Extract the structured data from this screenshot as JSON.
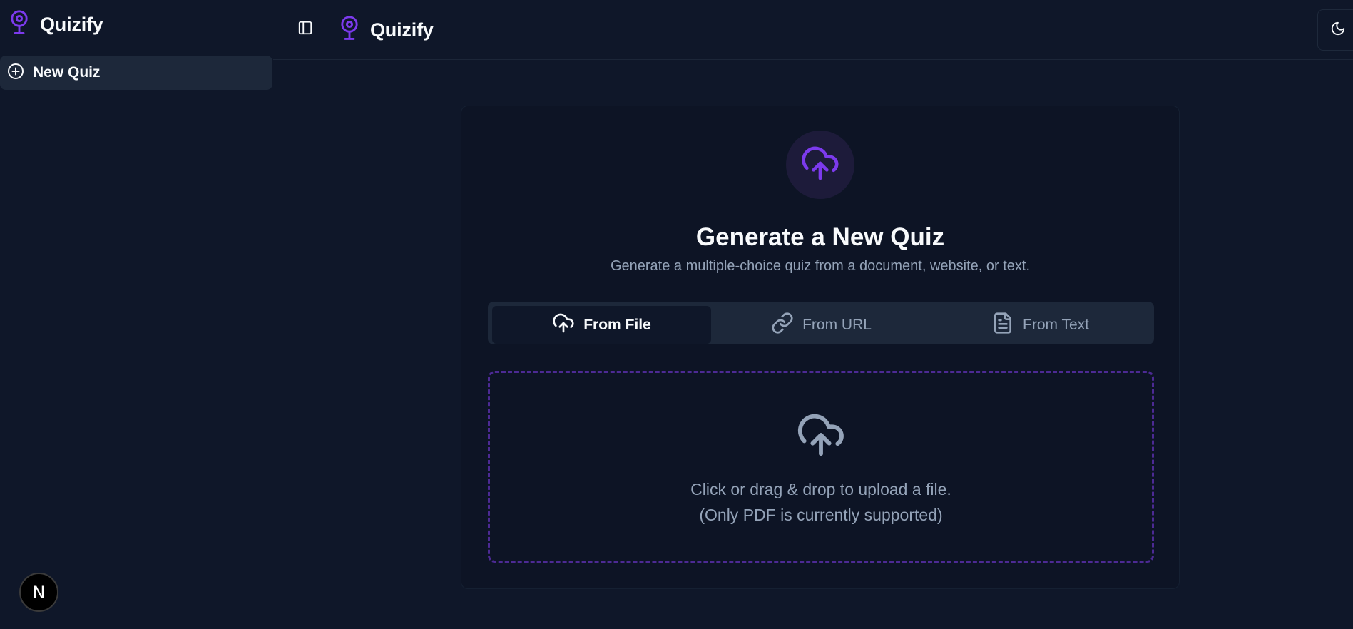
{
  "sidebar": {
    "brand": "Quizify",
    "items": [
      {
        "label": "New Quiz",
        "icon": "plus-circle-icon"
      }
    ],
    "badge": "N"
  },
  "header": {
    "brand": "Quizify",
    "toggle_icon": "sidebar-toggle-icon",
    "theme_icon": "moon-icon"
  },
  "card": {
    "title": "Generate a New Quiz",
    "subtitle": "Generate a multiple-choice quiz from a document, website, or text.",
    "tabs": [
      {
        "label": "From File",
        "icon": "cloud-upload-icon",
        "active": true
      },
      {
        "label": "From URL",
        "icon": "link-icon",
        "active": false
      },
      {
        "label": "From Text",
        "icon": "file-text-icon",
        "active": false
      }
    ],
    "dropzone": {
      "line1": "Click or drag & drop to upload a file.",
      "line2": "(Only PDF is currently supported)"
    }
  },
  "colors": {
    "background": "#0f1729",
    "accent": "#7c3aed",
    "muted_text": "#94a3b8",
    "surface": "#1d283a",
    "dropzone_border": "#4c2a94"
  }
}
